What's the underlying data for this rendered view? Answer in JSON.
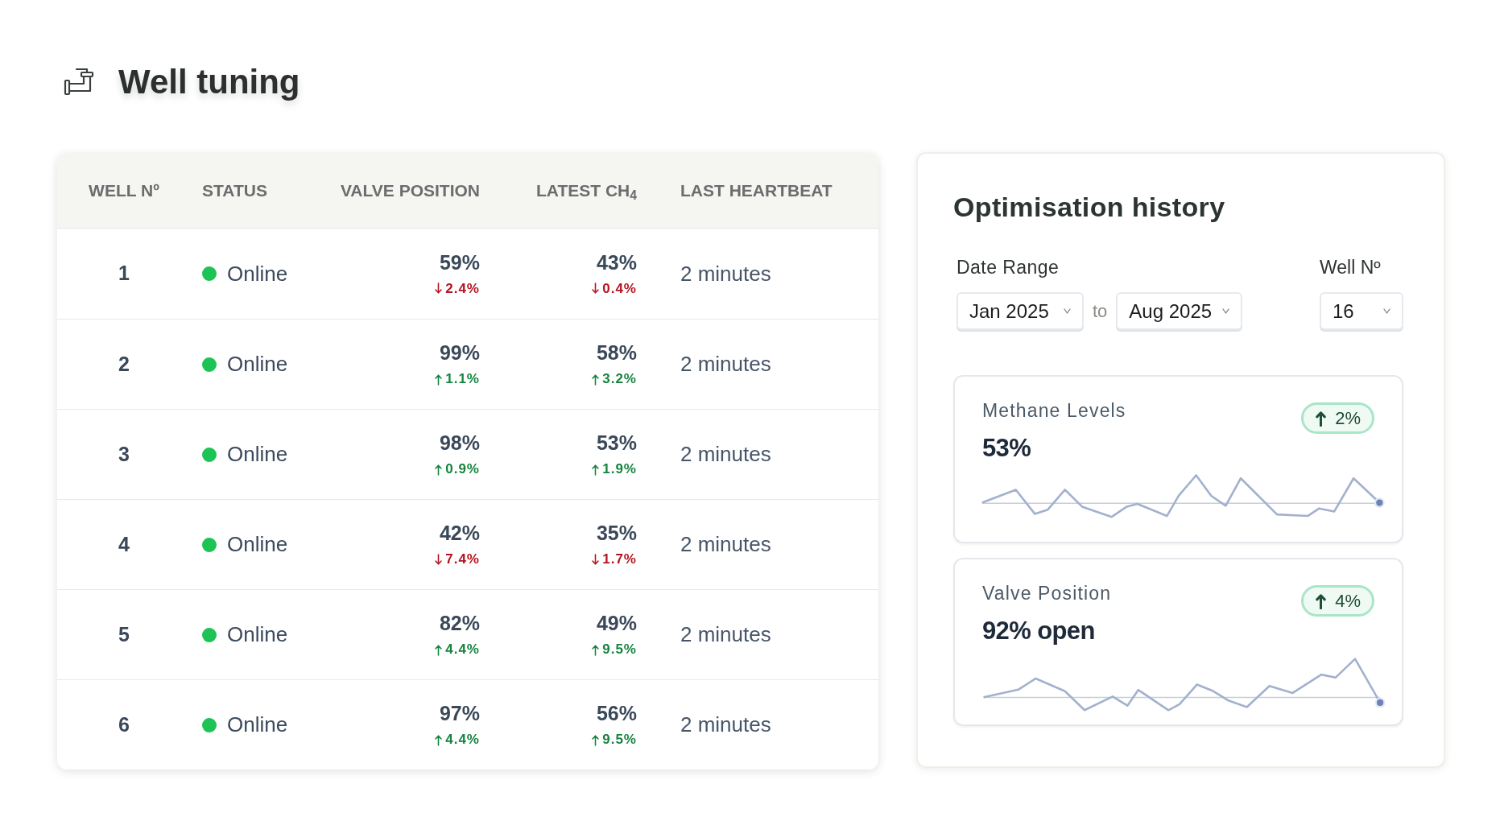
{
  "page": {
    "title": "Well tuning"
  },
  "wells_table": {
    "columns": [
      "WELL Nº",
      "STATUS",
      "VALVE POSITION",
      "LATEST CH$_{4}$",
      "LAST HEARTBEAT"
    ],
    "rows": [
      {
        "well": "1",
        "status": {
          "label": "Online",
          "color": "#1dc455"
        },
        "valve_position": {
          "value": "59%",
          "change": "2.4%",
          "up": false
        },
        "latest_ch4": {
          "value": "43%",
          "change": "0.4%",
          "up": false
        },
        "last_heartbeat": "2 minutes"
      },
      {
        "well": "2",
        "status": {
          "label": "Online",
          "color": "#1dc455"
        },
        "valve_position": {
          "value": "99%",
          "change": "1.1%",
          "up": true
        },
        "latest_ch4": {
          "value": "58%",
          "change": "3.2%",
          "up": true
        },
        "last_heartbeat": "2 minutes"
      },
      {
        "well": "3",
        "status": {
          "label": "Online",
          "color": "#1dc455"
        },
        "valve_position": {
          "value": "98%",
          "change": "0.9%",
          "up": true
        },
        "latest_ch4": {
          "value": "53%",
          "change": "1.9%",
          "up": true
        },
        "last_heartbeat": "2 minutes"
      },
      {
        "well": "4",
        "status": {
          "label": "Online",
          "color": "#1dc455"
        },
        "valve_position": {
          "value": "42%",
          "change": "7.4%",
          "up": false
        },
        "latest_ch4": {
          "value": "35%",
          "change": "1.7%",
          "up": false
        },
        "last_heartbeat": "2 minutes"
      },
      {
        "well": "5",
        "status": {
          "label": "Online",
          "color": "#1dc455"
        },
        "valve_position": {
          "value": "82%",
          "change": "4.4%",
          "up": true
        },
        "latest_ch4": {
          "value": "49%",
          "change": "9.5%",
          "up": true
        },
        "last_heartbeat": "2 minutes"
      },
      {
        "well": "6",
        "status": {
          "label": "Online",
          "color": "#1dc455"
        },
        "valve_position": {
          "value": "97%",
          "change": "4.4%",
          "up": true
        },
        "latest_ch4": {
          "value": "56%",
          "change": "9.5%",
          "up": true
        },
        "last_heartbeat": "2 minutes"
      }
    ]
  },
  "optimisation_history": {
    "title": "Optimisation history",
    "date_range": {
      "label": "Date Range",
      "from": "Jan 2025",
      "separator": "to",
      "to": "Aug 2025"
    },
    "well_filter": {
      "label": "Well Nº",
      "value": "16"
    },
    "metrics": [
      {
        "title": "Methane Levels",
        "value": "53%",
        "change": {
          "value": "2%",
          "up": true
        }
      },
      {
        "title": "Valve Position",
        "value": "92% open",
        "change": {
          "value": "4%",
          "up": true
        }
      }
    ]
  }
}
